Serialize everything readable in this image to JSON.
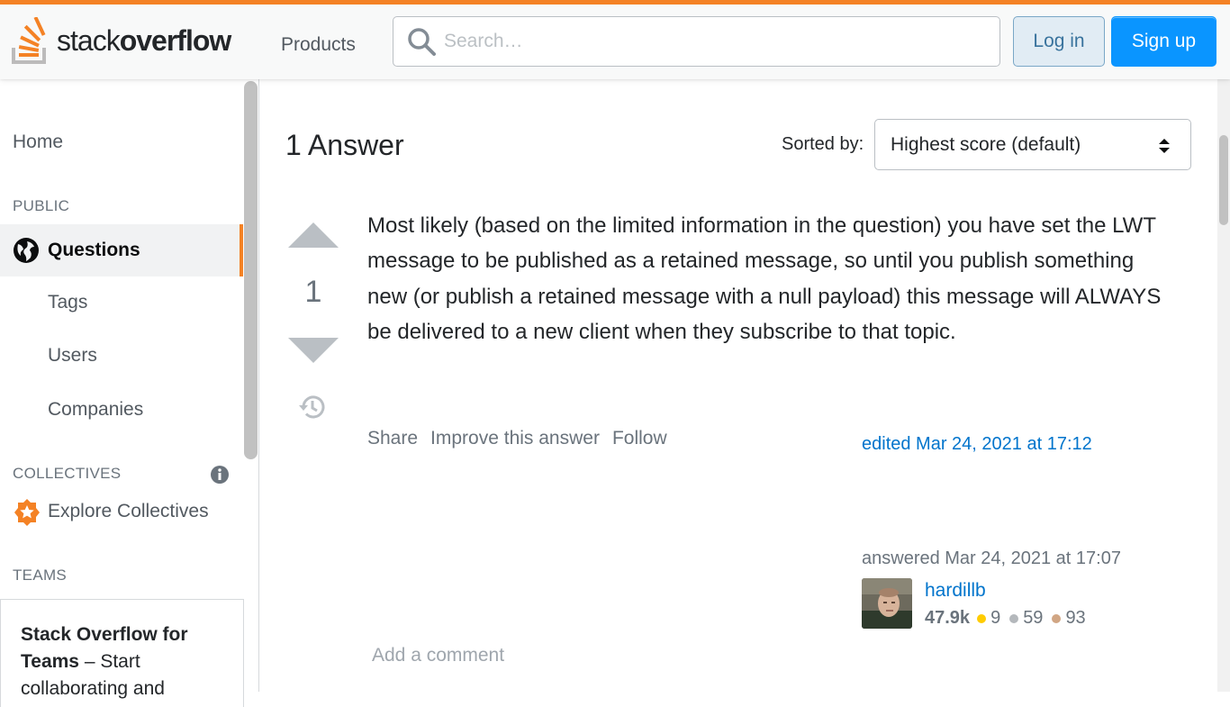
{
  "header": {
    "logo_text_light": "stack",
    "logo_text_bold": "overflow",
    "products_label": "Products",
    "search_placeholder": "Search…",
    "login_label": "Log in",
    "signup_label": "Sign up",
    "accent_color": "#f48225",
    "primary_color": "#0a95ff"
  },
  "sidebar": {
    "home": "Home",
    "public_heading": "PUBLIC",
    "questions": "Questions",
    "tags": "Tags",
    "users": "Users",
    "companies": "Companies",
    "collectives_heading": "COLLECTIVES",
    "explore_collectives": "Explore Collectives",
    "teams_heading": "TEAMS",
    "teams_bold": "Stack Overflow for Teams",
    "teams_text": " – Start collaborating and"
  },
  "main": {
    "ghost_comment": "Add a comment",
    "answers_title": "1 Answer",
    "sorted_by_label": "Sorted by:",
    "sort_value": "Highest score (default)",
    "answer": {
      "score": "1",
      "body": "Most likely (based on the limited information in the question) you have set the LWT message to be published as a retained message, so until you publish something new (or publish a retained message with a null payload) this message will ALWAYS be delivered to a new client when they subscribe to that topic.",
      "menu": [
        "Share",
        "Improve this answer",
        "Follow"
      ],
      "edited": "edited Mar 24, 2021 at 17:12",
      "answered": "answered Mar 24, 2021 at 17:07",
      "user": {
        "name": "hardillb",
        "reputation": "47.9k",
        "gold": "9",
        "silver": "59",
        "bronze": "93",
        "gold_color": "#ffcc01",
        "silver_color": "#b4b8bc",
        "bronze_color": "#d1a684"
      },
      "add_comment": "Add a comment"
    }
  }
}
